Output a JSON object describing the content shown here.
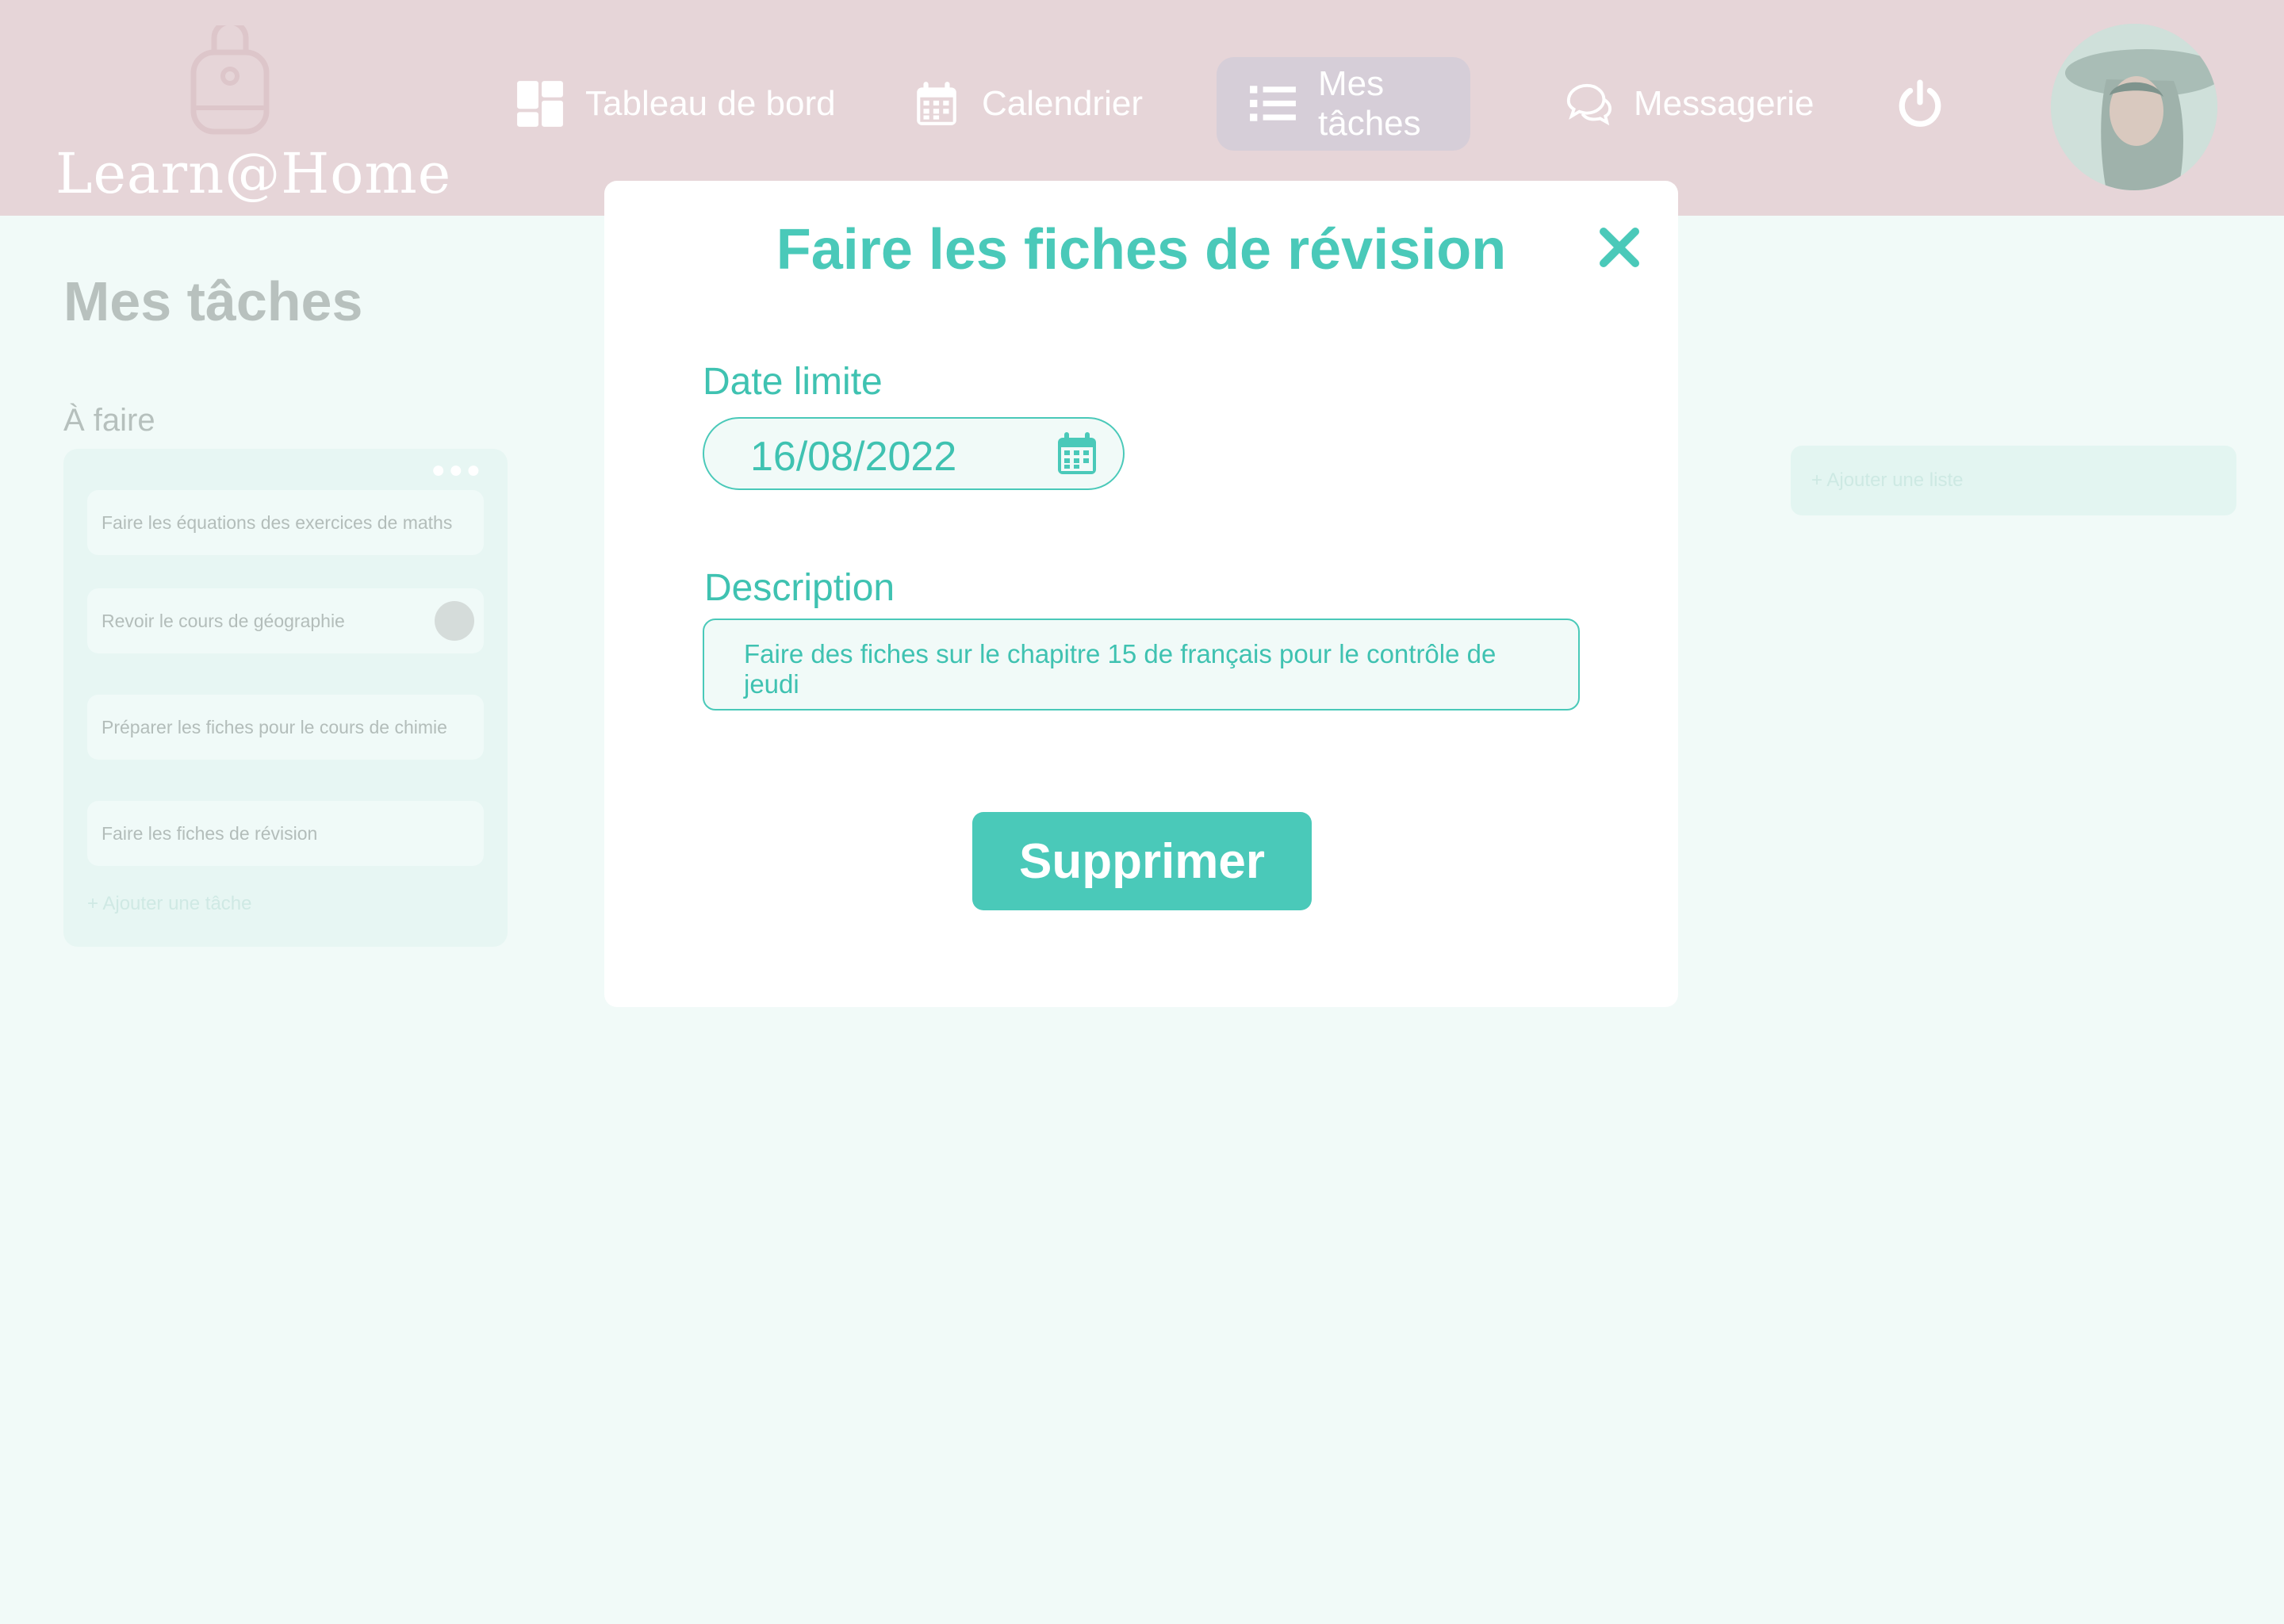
{
  "app": {
    "brand": "Learn@Home"
  },
  "nav": {
    "items": [
      {
        "label": "Tableau de bord",
        "icon": "dashboard-icon"
      },
      {
        "label": "Calendrier",
        "icon": "calendar-icon"
      },
      {
        "label": "Mes tâches",
        "icon": "list-icon",
        "active": true
      },
      {
        "label": "Messagerie",
        "icon": "chat-icon"
      }
    ],
    "power_icon": "power-icon",
    "avatar_icon": "user-avatar"
  },
  "page": {
    "title": "Mes tâches",
    "list": {
      "title": "À faire",
      "tasks": [
        "Faire les équations des exercices de maths",
        "Revoir le cours de géographie",
        "Préparer les fiches pour le cours de chimie",
        "Faire les fiches de révision"
      ],
      "add_task": "+ Ajouter une tâche"
    },
    "add_list": "+ Ajouter une liste"
  },
  "modal": {
    "title": "Faire les fiches de révision",
    "date_label": "Date limite",
    "date_value": "16/08/2022",
    "description_label": "Description",
    "description_value": "Faire des fiches sur le chapitre 15 de français pour le contrôle de jeudi",
    "delete_label": "Supprimer"
  },
  "colors": {
    "accent": "#4ac9b9",
    "header_bg": "#e6d5d8",
    "page_bg": "#f1faf8"
  }
}
